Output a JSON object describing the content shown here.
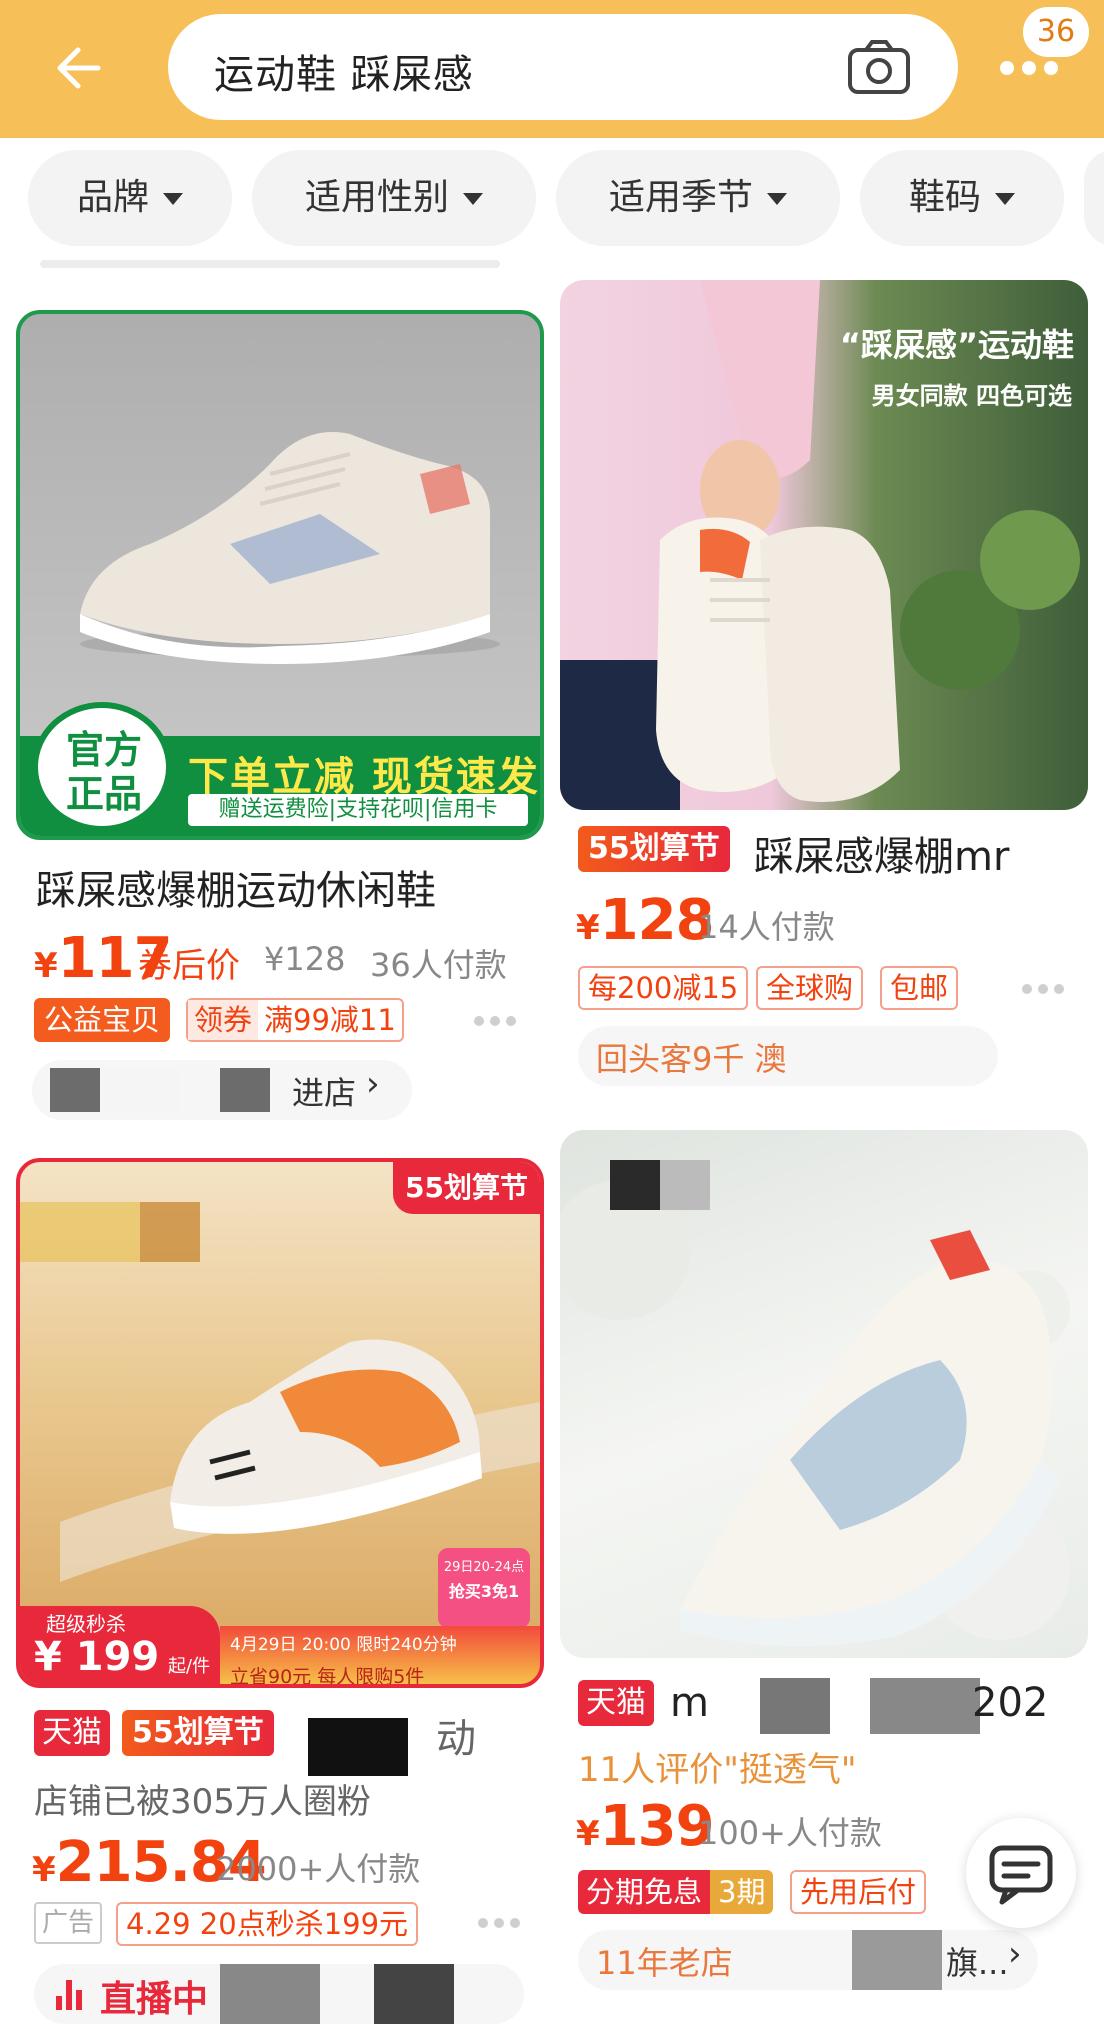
{
  "header": {
    "search_query": "运动鞋 踩屎感",
    "badge_count": "36",
    "back_icon": "arrow-left-icon",
    "camera_icon": "camera-icon",
    "more_icon": "more-dots-icon"
  },
  "filters": [
    {
      "label": "品牌"
    },
    {
      "label": "适用性别"
    },
    {
      "label": "适用季节"
    },
    {
      "label": "鞋码"
    }
  ],
  "cards": [
    {
      "image_banner": "下单立减 现货速发",
      "image_badge": "官方正品",
      "image_sub": "赠送运费险|支持花呗|信用卡",
      "title": "踩屎感爆棚运动休闲鞋",
      "price_yen": "¥",
      "price": "117",
      "price_note": "券后价",
      "orig_price": "¥128",
      "sales": "36人付款",
      "tag_solid": "公益宝贝",
      "coupon_label": "领券",
      "coupon_value": "满99减11",
      "shop_link": "进店"
    },
    {
      "image_headline": "“踩屎感”运动鞋",
      "image_sub": "男女同款 四色可选",
      "promo": "55划算节",
      "title": "踩屎感爆棚mr",
      "price_yen": "¥",
      "price": "128",
      "sales": "14人付款",
      "tags": [
        "每200减15",
        "全球购",
        "包邮"
      ],
      "shop_text": "回头客9千 澳"
    },
    {
      "image_corner": "55划算节",
      "image_flash_label": "超级秒杀",
      "image_flash_price": "¥ 199",
      "image_flash_unit": "起/件",
      "image_time": "4月29日 20:00 限时240分钟",
      "image_save": "立省90元 每人限购5件",
      "image_cat_line1": "29日20-24点",
      "image_cat_line2": "抢买3免1",
      "tmall": "天猫",
      "promo": "55划算节",
      "title_tail": "动",
      "fans": "店铺已被305万人圈粉",
      "price_yen": "¥",
      "price": "215.84",
      "sales": "2000+人付款",
      "ad": "广告",
      "flash_tag": "4.29 20点秒杀199元",
      "live": "直播中"
    },
    {
      "tmall": "天猫",
      "title_head": "m",
      "title_tail": "202",
      "review": "11人评价\"挺透气\"",
      "price_yen": "¥",
      "price": "139",
      "sales": "100+人付款",
      "installment": "分期免息",
      "installment_n": "3期",
      "pay_later": "先用后付",
      "shop_age": "11年老店",
      "shop_tail": "旗..."
    }
  ],
  "floating": {
    "chat_icon": "chat-bubble-icon"
  }
}
